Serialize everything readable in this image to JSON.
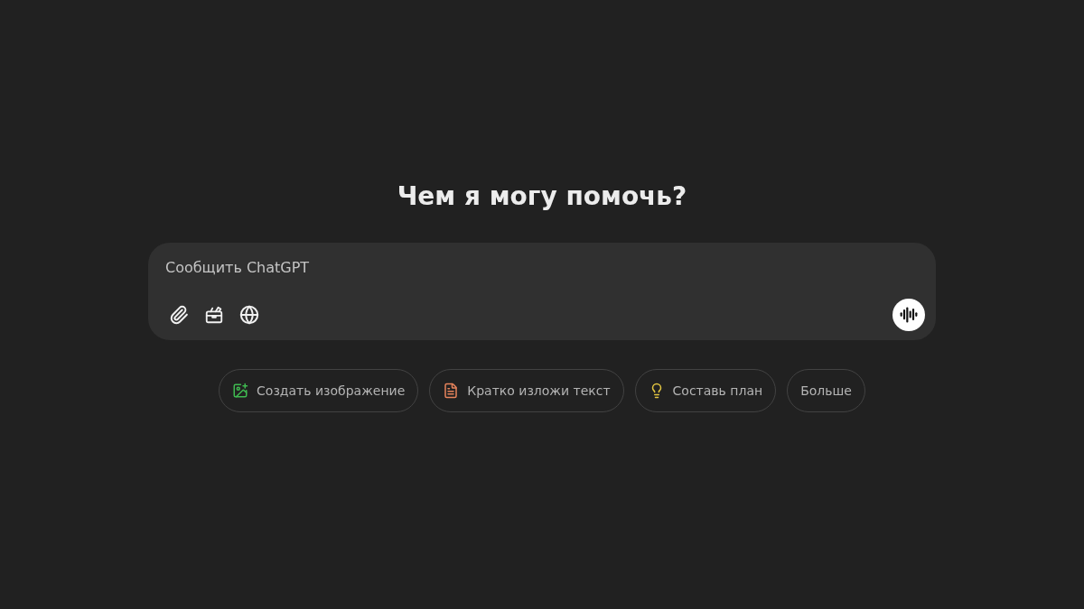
{
  "heading": "Чем я могу помочь?",
  "composer": {
    "placeholder": "Сообщить ChatGPT"
  },
  "chips": [
    {
      "kind": "image",
      "label": "Создать изображение",
      "color": "#3fb950"
    },
    {
      "kind": "document",
      "label": "Кратко изложи текст",
      "color": "#e8845c"
    },
    {
      "kind": "idea",
      "label": "Составь план",
      "color": "#e2c541"
    },
    {
      "kind": "text",
      "label": "Больше"
    }
  ]
}
